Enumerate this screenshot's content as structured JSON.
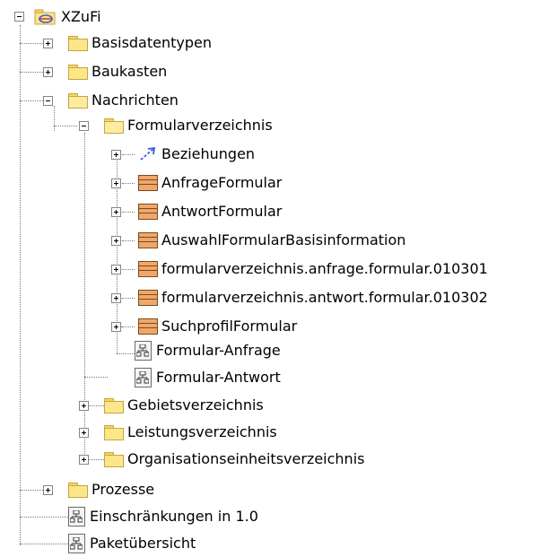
{
  "tree": {
    "root": {
      "label": "XZuFi",
      "icon": "package-root-icon"
    },
    "l1": [
      {
        "label": "Basisdatentypen",
        "icon": "folder-icon"
      },
      {
        "label": "Baukasten",
        "icon": "folder-icon"
      },
      {
        "label": "Nachrichten",
        "icon": "folder-icon"
      }
    ],
    "formularverzeichnis": {
      "label": "Formularverzeichnis",
      "icon": "folder-icon"
    },
    "formular_children": [
      {
        "label": "Beziehungen",
        "icon": "relation-icon"
      },
      {
        "label": "AnfrageFormular",
        "icon": "class-icon"
      },
      {
        "label": "AntwortFormular",
        "icon": "class-icon"
      },
      {
        "label": "AuswahlFormularBasisinformation",
        "icon": "class-icon"
      },
      {
        "label": "formularverzeichnis.anfrage.formular.010301",
        "icon": "class-icon"
      },
      {
        "label": "formularverzeichnis.antwort.formular.010302",
        "icon": "class-icon"
      },
      {
        "label": "SuchprofilFormular",
        "icon": "class-icon"
      },
      {
        "label": "Formular-Anfrage",
        "icon": "diagram-icon"
      },
      {
        "label": "Formular-Antwort",
        "icon": "diagram-icon"
      }
    ],
    "nachrichten_rest": [
      {
        "label": "Gebietsverzeichnis",
        "icon": "folder-icon"
      },
      {
        "label": "Leistungsverzeichnis",
        "icon": "folder-icon"
      },
      {
        "label": "Organisationseinheitsverzeichnis",
        "icon": "folder-icon"
      }
    ],
    "root_rest": [
      {
        "label": "Prozesse",
        "icon": "folder-icon"
      },
      {
        "label": "Einschränkungen in 1.0",
        "icon": "diagram-icon"
      },
      {
        "label": "Paketübersicht",
        "icon": "diagram-icon"
      }
    ]
  },
  "colors": {
    "folder_fill": "#fbe78a",
    "class_fill": "#f0a86a",
    "relation_blue": "#3b5bd6",
    "tree_lines": "#7a7a7a"
  }
}
